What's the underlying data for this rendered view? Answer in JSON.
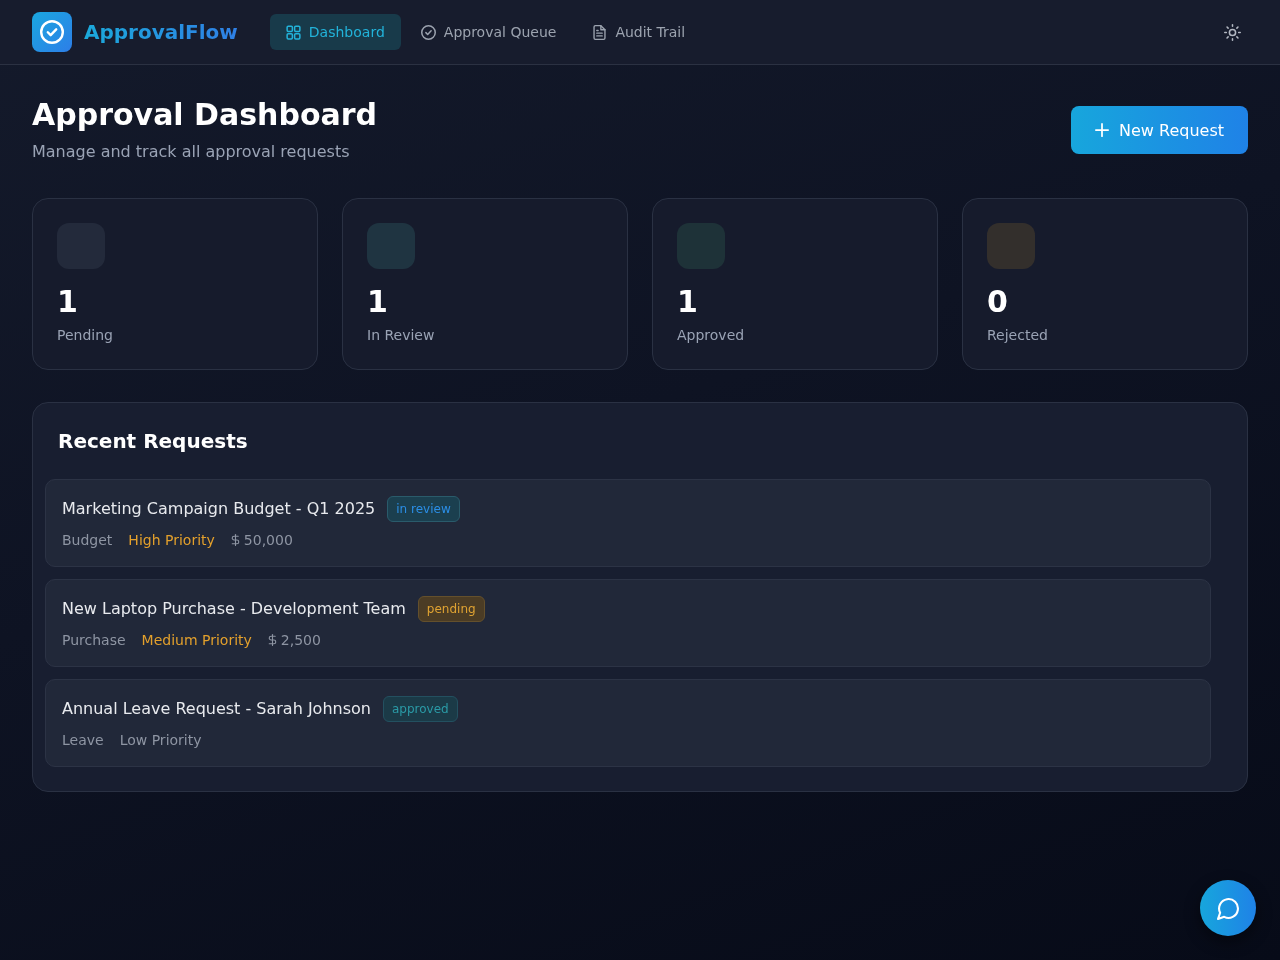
{
  "app": {
    "name": "ApprovalFlow"
  },
  "nav": [
    {
      "label": "Dashboard",
      "selected": true
    },
    {
      "label": "Approval Queue",
      "selected": false
    },
    {
      "label": "Audit Trail",
      "selected": false
    }
  ],
  "page": {
    "title": "Approval Dashboard",
    "subtitle": "Manage and track all approval requests",
    "action": "New Request"
  },
  "stats": [
    {
      "value": "1",
      "label": "Pending",
      "color": "#232a3b"
    },
    {
      "value": "1",
      "label": "In Review",
      "color": "#1f3441"
    },
    {
      "value": "1",
      "label": "Approved",
      "color": "#1e3238"
    },
    {
      "value": "0",
      "label": "Rejected",
      "color": "#332f2c"
    }
  ],
  "recent": {
    "title": "Recent Requests",
    "requests": [
      {
        "title": "Marketing Campaign Budget - Q1 2025",
        "status": {
          "label": "in review",
          "kind": "review"
        },
        "category": "Budget",
        "priority": {
          "label": "High Priority",
          "kind": "high"
        },
        "amount": "50,000"
      },
      {
        "title": "New Laptop Purchase - Development Team",
        "status": {
          "label": "pending",
          "kind": "pending"
        },
        "category": "Purchase",
        "priority": {
          "label": "Medium Priority",
          "kind": "medium"
        },
        "amount": "2,500"
      },
      {
        "title": "Annual Leave Request - Sarah Johnson",
        "status": {
          "label": "approved",
          "kind": "approved"
        },
        "category": "Leave",
        "priority": {
          "label": "Low Priority",
          "kind": "low"
        }
      }
    ]
  }
}
